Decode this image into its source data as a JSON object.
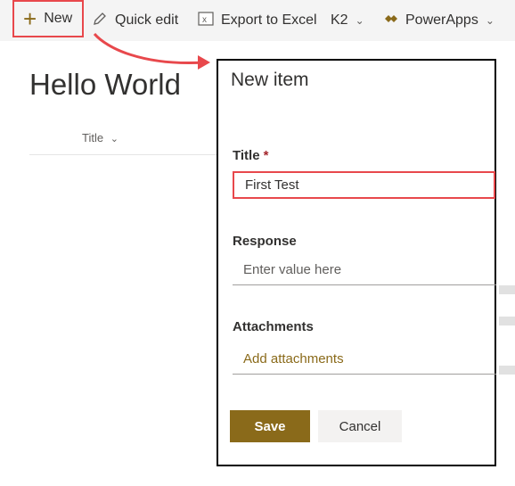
{
  "toolbar": {
    "new_label": "New",
    "quick_edit_label": "Quick edit",
    "export_label": "Export to Excel",
    "k2_label": "K2",
    "powerapps_label": "PowerApps"
  },
  "list": {
    "title": "Hello World",
    "column_title": "Title"
  },
  "panel": {
    "header": "New item",
    "title_label": "Title",
    "required_marker": "*",
    "title_value": "First Test",
    "response_label": "Response",
    "response_placeholder": "Enter value here",
    "attachments_label": "Attachments",
    "add_attachments": "Add attachments",
    "save_label": "Save",
    "cancel_label": "Cancel"
  },
  "colors": {
    "accent": "#8a6a1a",
    "highlight": "#e8484c"
  }
}
